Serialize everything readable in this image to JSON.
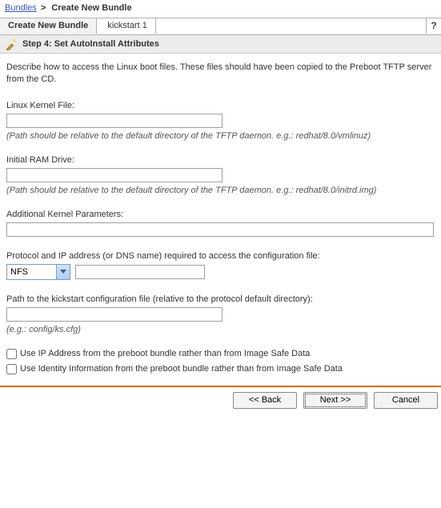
{
  "breadcrumb": {
    "root": "Bundles",
    "sep": ">",
    "current": "Create New Bundle"
  },
  "tabs": {
    "main": "Create New Bundle",
    "second": "kickstart 1",
    "help": "?"
  },
  "step_title": "Step 4: Set AutoInstall Attributes",
  "intro": "Describe how to access the Linux boot files. These files should have been copied to the Preboot TFTP server from the CD.",
  "kernel": {
    "label": "Linux Kernel File:",
    "value": "",
    "hint": "(Path should be relative to the default directory of the TFTP daemon. e.g.: redhat/8.0/vmlinuz)"
  },
  "initrd": {
    "label": "Initial RAM Drive:",
    "value": "",
    "hint": "(Path should be relative to the default directory of the TFTP daemon. e.g.: redhat/8.0/initrd.img)"
  },
  "params": {
    "label": "Additional Kernel Parameters:",
    "value": ""
  },
  "protocol": {
    "label": "Protocol and IP address (or DNS name) required to access the configuration file:",
    "selected": "NFS",
    "address": ""
  },
  "kspath": {
    "label": "Path to the kickstart configuration file (relative to the protocol default directory):",
    "value": "",
    "hint": "(e.g.: config/ks.cfg)"
  },
  "checks": {
    "use_ip": "Use IP Address from the preboot bundle rather than from Image Safe Data",
    "use_identity": "Use Identity Information from the preboot bundle rather than from Image Safe Data"
  },
  "buttons": {
    "back": "<< Back",
    "next": "Next >>",
    "cancel": "Cancel"
  }
}
